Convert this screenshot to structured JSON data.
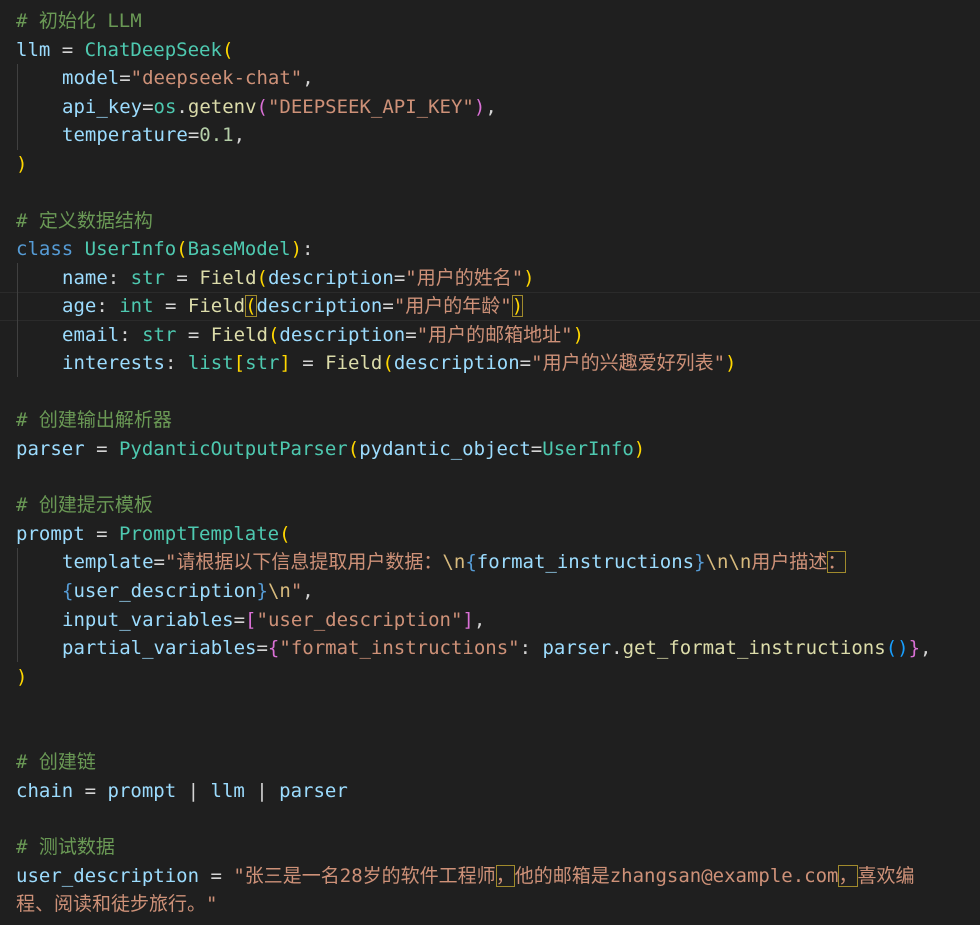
{
  "code": {
    "c_init": "# 初始化 LLM",
    "llm": "llm",
    "eq": " = ",
    "chat_deepseek": "ChatDeepSeek",
    "model": "model",
    "model_val": "\"deepseek-chat\"",
    "api_key": "api_key",
    "os": "os",
    "getenv": "getenv",
    "env_val": "\"DEEPSEEK_API_KEY\"",
    "temperature": "temperature",
    "temp_val": "0.1",
    "c_struct": "# 定义数据结构",
    "class_kw": "class",
    "userinfo": "UserInfo",
    "basemodel": "BaseModel",
    "name": "name",
    "str": "str",
    "int": "int",
    "list": "list",
    "field": "Field",
    "description": "description",
    "desc_name": "\"用户的姓名\"",
    "age": "age",
    "desc_age": "\"用户的年龄\"",
    "email": "email",
    "desc_email": "\"用户的邮箱地址\"",
    "interests": "interests",
    "desc_interests": "\"用户的兴趣爱好列表\"",
    "c_parser": "# 创建输出解析器",
    "parser": "parser",
    "pydantic_parser": "PydanticOutputParser",
    "pydantic_object": "pydantic_object",
    "c_prompt": "# 创建提示模板",
    "prompt": "prompt",
    "prompt_template": "PromptTemplate",
    "template": "template",
    "tpl_a": "\"请根据以下信息提取用户数据：",
    "esc_n": "\\n",
    "format_instructions": "format_instructions",
    "tpl_b": "用户描述",
    "tpl_colon": "：",
    "user_description": "user_description",
    "quote": "\"",
    "input_variables": "input_variables",
    "iv_val": "\"user_description\"",
    "partial_variables": "partial_variables",
    "pv_key": "\"format_instructions\"",
    "get_format_instructions": "get_format_instructions",
    "c_chain": "# 创建链",
    "chain": "chain",
    "pipe": " | ",
    "c_test": "# 测试数据",
    "ud_a": "\"张三是一名28岁的软件工程师",
    "ud_comma": "，",
    "ud_b": "他的邮箱是zhangsan@example.com",
    "ud_c": "喜欢编",
    "ud_d": "程、阅读和徒步旅行。\""
  }
}
